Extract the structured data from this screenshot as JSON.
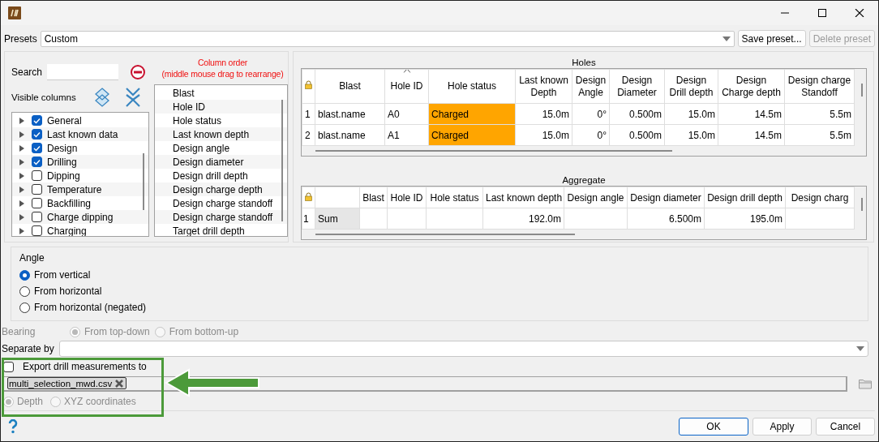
{
  "presets": {
    "label": "Presets",
    "value": "Custom",
    "buttons": [
      {
        "label": "Save preset...",
        "disabled": false
      },
      {
        "label": "Delete preset",
        "disabled": true
      }
    ]
  },
  "search": {
    "label": "Search"
  },
  "visible_columns": {
    "label": "Visible columns",
    "items": [
      {
        "label": "General",
        "checked": true
      },
      {
        "label": "Last known data",
        "checked": true
      },
      {
        "label": "Design",
        "checked": true
      },
      {
        "label": "Drilling",
        "checked": true
      },
      {
        "label": "Dipping",
        "checked": false
      },
      {
        "label": "Temperature",
        "checked": false
      },
      {
        "label": "Backfilling",
        "checked": false
      },
      {
        "label": "Charge dipping",
        "checked": false
      },
      {
        "label": "Charging",
        "checked": false
      }
    ]
  },
  "column_order": {
    "title": "Column order",
    "hint": "(middle mouse drag to rearrange)",
    "items": [
      "Blast",
      "Hole ID",
      "Hole status",
      "Last known depth",
      "Design angle",
      "Design diameter",
      "Design drill depth",
      "Design charge depth",
      "Design charge standoff",
      "Design charge standoff",
      "Target drill depth"
    ]
  },
  "holes": {
    "title": "Holes",
    "columns": [
      {
        "label": "Blast",
        "sorted": false
      },
      {
        "label": "Hole ID",
        "sorted": true
      },
      {
        "label": "Hole status",
        "sorted": false
      },
      {
        "label": "Last known Depth",
        "sorted": false
      },
      {
        "label": "Design Angle",
        "sorted": false
      },
      {
        "label": "Design Diameter",
        "sorted": false
      },
      {
        "label": "Design Drill depth",
        "sorted": false
      },
      {
        "label": "Design Charge depth",
        "sorted": false
      },
      {
        "label": "Design charge Standoff",
        "sorted": false
      }
    ],
    "rows": [
      {
        "index": "1",
        "cells": [
          {
            "text": "blast.name"
          },
          {
            "text": "A0"
          },
          {
            "text": "Charged",
            "color": "#ffa500"
          },
          {
            "text": "15.0m"
          },
          {
            "text": "0°"
          },
          {
            "text": "0.500m"
          },
          {
            "text": "15.0m"
          },
          {
            "text": "14.5m"
          },
          {
            "text": "5.5m"
          }
        ]
      },
      {
        "index": "2",
        "cells": [
          {
            "text": "blast.name"
          },
          {
            "text": "A1"
          },
          {
            "text": "Charged",
            "color": "#ffa500"
          },
          {
            "text": "15.0m"
          },
          {
            "text": "0°"
          },
          {
            "text": "0.500m"
          },
          {
            "text": "15.0m"
          },
          {
            "text": "14.5m"
          },
          {
            "text": "5.5m"
          }
        ]
      }
    ]
  },
  "aggregate": {
    "title": "Aggregate",
    "columns": [
      "Blast",
      "Hole ID",
      "Hole status",
      "Last known depth",
      "Design angle",
      "Design diameter",
      "Design drill depth",
      "Design charg"
    ],
    "rows": [
      {
        "index": "1",
        "label": "Sum",
        "cells": [
          null,
          null,
          null,
          "192.0m",
          null,
          "6.500m",
          "195.0m",
          null
        ]
      }
    ]
  },
  "angle": {
    "title": "Angle",
    "options": [
      {
        "label": "From vertical",
        "selected": true
      },
      {
        "label": "From horizontal",
        "selected": false
      },
      {
        "label": "From horizontal (negated)",
        "selected": false
      }
    ]
  },
  "bearing": {
    "label": "Bearing",
    "disabled": true,
    "options": [
      {
        "label": "From top-down",
        "selected": true
      },
      {
        "label": "From bottom-up",
        "selected": false
      }
    ]
  },
  "separate_by": {
    "label": "Separate by"
  },
  "export": {
    "label": "Export drill measurements to",
    "checked": false,
    "file": "multi_selection_mwd.csv",
    "disabled": true,
    "options": [
      {
        "label": "Depth",
        "selected": true
      },
      {
        "label": "XYZ coordinates",
        "selected": false
      }
    ]
  },
  "buttons": [
    {
      "label": "OK",
      "default": true
    },
    {
      "label": "Apply",
      "default": false
    },
    {
      "label": "Cancel",
      "default": false
    }
  ]
}
